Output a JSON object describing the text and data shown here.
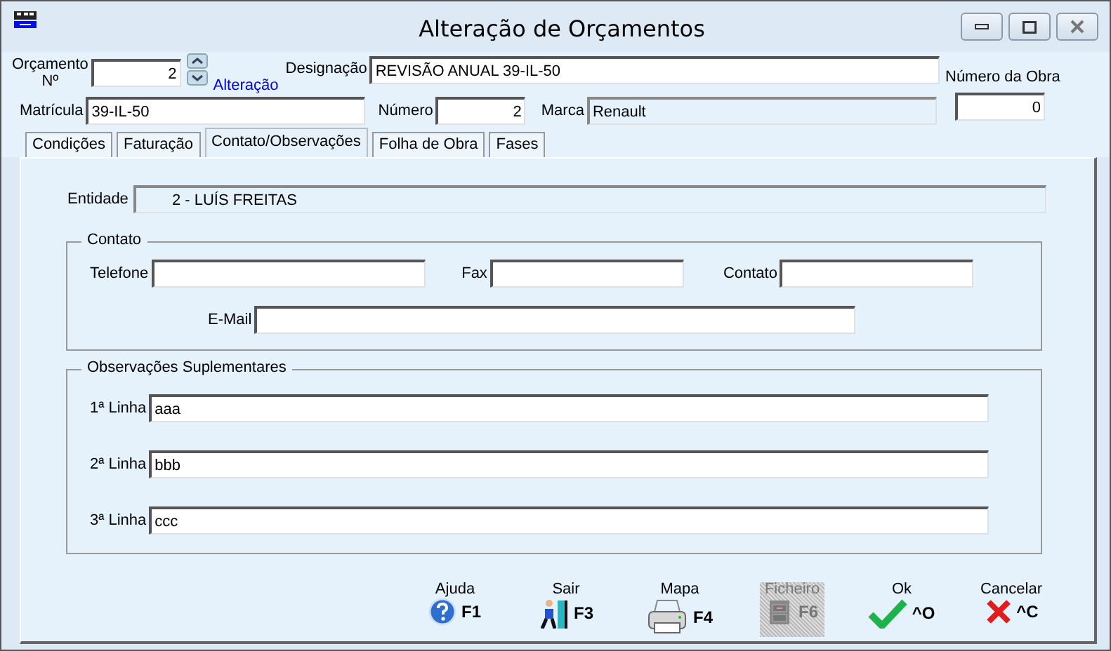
{
  "window": {
    "title": "Alteração de Orçamentos"
  },
  "header": {
    "budget_label": "Orçamento Nº",
    "budget_value": "2",
    "mode_link": "Alteração",
    "designation_label": "Designação",
    "designation_value": "REVISÃO ANUAL 39-IL-50",
    "plate_label": "Matrícula",
    "plate_value": "39-IL-50",
    "number_label": "Número",
    "number_value": "2",
    "brand_label": "Marca",
    "brand_value": "Renault",
    "work_number_label": "Número da Obra",
    "work_number_value": "0"
  },
  "tabs": [
    {
      "label": "Condições",
      "selected": false
    },
    {
      "label": "Faturação",
      "selected": false
    },
    {
      "label": "Contato/Observações",
      "selected": true
    },
    {
      "label": "Folha de Obra",
      "selected": false
    },
    {
      "label": "Fases",
      "selected": false
    }
  ],
  "entity": {
    "label": "Entidade",
    "value": "2 - LUÍS FREITAS"
  },
  "contact": {
    "title": "Contato",
    "phone_label": "Telefone",
    "fax_label": "Fax",
    "contact_label": "Contato",
    "email_label": "E-Mail"
  },
  "observations": {
    "title": "Observações Suplementares",
    "lines": [
      {
        "label": "1ª Linha",
        "value": "aaa"
      },
      {
        "label": "2ª Linha",
        "value": "bbb"
      },
      {
        "label": "3ª Linha",
        "value": "ccc"
      }
    ]
  },
  "toolbar": [
    {
      "kind": "help",
      "label": "Ajuda",
      "key": "F1",
      "disabled": false
    },
    {
      "kind": "exit",
      "label": "Sair",
      "key": "F3",
      "disabled": false
    },
    {
      "kind": "print",
      "label": "Mapa",
      "key": "F4",
      "disabled": false
    },
    {
      "kind": "file",
      "label": "Ficheiro",
      "key": "F6",
      "disabled": true
    },
    {
      "kind": "ok",
      "label": "Ok",
      "key": "^O",
      "disabled": false
    },
    {
      "kind": "cancel",
      "label": "Cancelar",
      "key": "^C",
      "disabled": false
    }
  ]
}
